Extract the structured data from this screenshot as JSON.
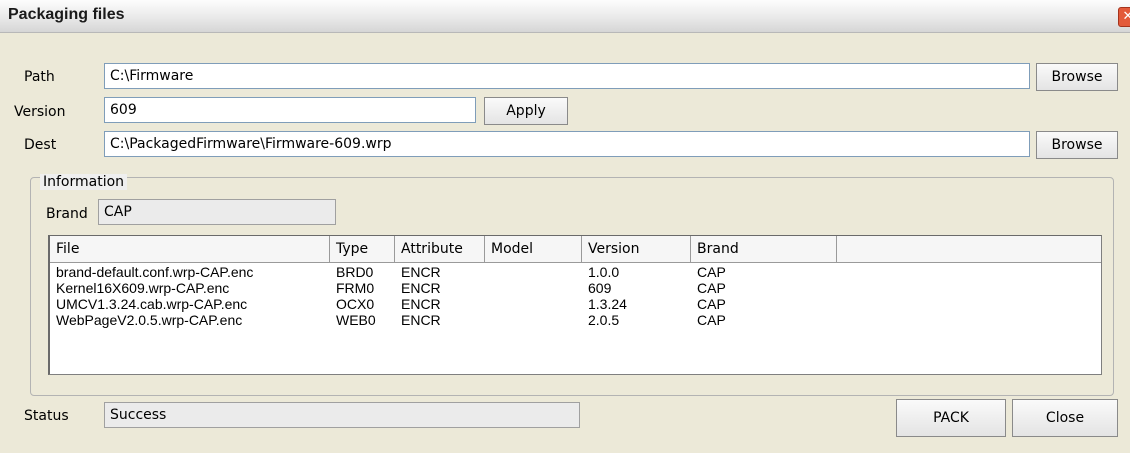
{
  "window": {
    "title": "Packaging files",
    "close_glyph": "✕"
  },
  "path": {
    "label": "Path",
    "value": "C:\\Firmware",
    "browse_label": "Browse"
  },
  "version": {
    "label": "Version",
    "value": "609",
    "apply_label": "Apply"
  },
  "dest": {
    "label": "Dest",
    "value": "C:\\PackagedFirmware\\Firmware-609.wrp",
    "browse_label": "Browse"
  },
  "information": {
    "legend": "Information",
    "brand_label": "Brand",
    "brand_value": "CAP",
    "columns": [
      "File",
      "Type",
      "Attribute",
      "Model",
      "Version",
      "Brand",
      ""
    ],
    "rows": [
      [
        "brand-default.conf.wrp-CAP.enc",
        "BRD0",
        "ENCR",
        "",
        "1.0.0",
        "CAP"
      ],
      [
        "Kernel16X609.wrp-CAP.enc",
        "FRM0",
        "ENCR",
        "",
        "609",
        "CAP"
      ],
      [
        "UMCV1.3.24.cab.wrp-CAP.enc",
        "OCX0",
        "ENCR",
        "",
        "1.3.24",
        "CAP"
      ],
      [
        "WebPageV2.0.5.wrp-CAP.enc",
        "WEB0",
        "ENCR",
        "",
        "2.0.5",
        "CAP"
      ]
    ]
  },
  "status": {
    "label": "Status",
    "value": "Success"
  },
  "buttons": {
    "pack": "PACK",
    "close": "Close"
  },
  "colors": {
    "window_bg": "#efefef",
    "close_red": "#e35a3a",
    "field_border": "#7f9db9"
  },
  "icons": {
    "title_close": "close-icon"
  }
}
